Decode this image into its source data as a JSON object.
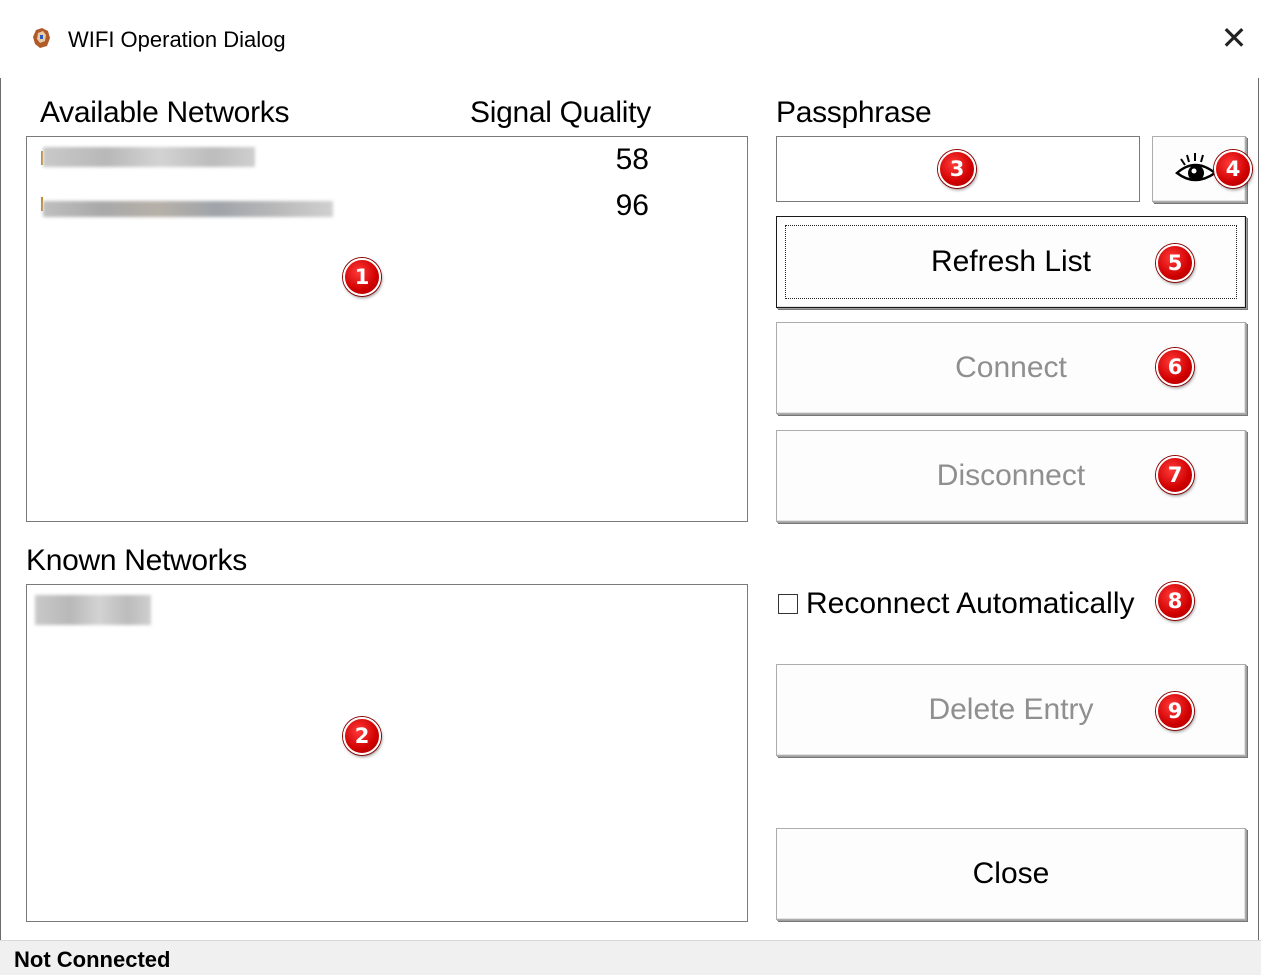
{
  "window": {
    "title": "WIFI Operation Dialog",
    "close_glyph": "✕",
    "app_icon": "wifi-app-icon"
  },
  "available": {
    "label": "Available Networks",
    "signal_label": "Signal Quality",
    "rows": [
      {
        "signal": "58"
      },
      {
        "signal": "96"
      }
    ]
  },
  "known": {
    "label": "Known Networks"
  },
  "passphrase": {
    "label": "Passphrase",
    "value": "",
    "show_icon": "eye-icon"
  },
  "buttons": {
    "refresh": "Refresh List",
    "connect": "Connect",
    "disconnect": "Disconnect",
    "delete": "Delete Entry",
    "close": "Close"
  },
  "reconnect": {
    "label": "Reconnect Automatically",
    "checked": false
  },
  "badges": [
    "1",
    "2",
    "3",
    "4",
    "5",
    "6",
    "7",
    "8",
    "9"
  ],
  "status": {
    "text": "Not Connected"
  },
  "colors": {
    "badge": "#d00000",
    "disabled_text": "#8f8f8f",
    "statusbar": "#f0f0f0"
  }
}
